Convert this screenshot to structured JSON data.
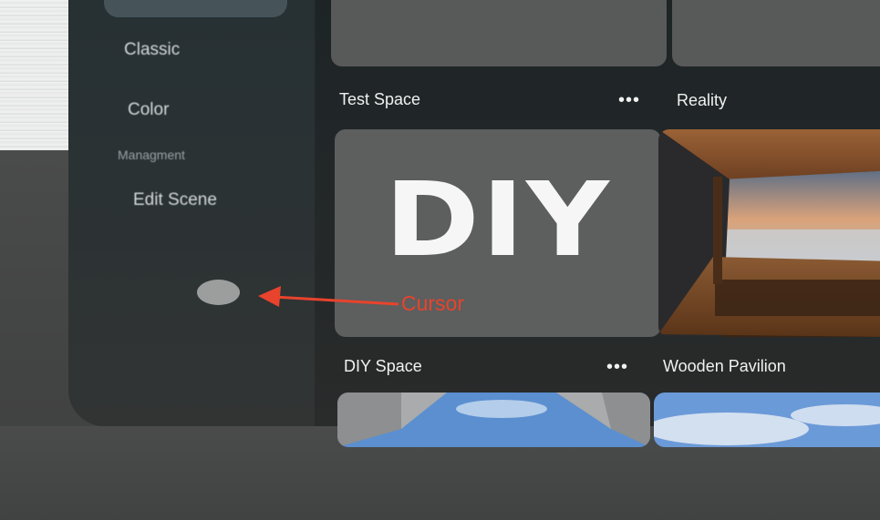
{
  "sidebar": {
    "items": [
      {
        "label": "Classic"
      },
      {
        "label": "Color"
      },
      {
        "label": "Edit Scene"
      }
    ],
    "section_label": "Managment"
  },
  "spaces": [
    {
      "name": "Test Space",
      "more": "•••"
    },
    {
      "name": "Reality"
    },
    {
      "name": "DIY Space",
      "more": "•••"
    },
    {
      "name": "Wooden Pavilion"
    }
  ],
  "diy_tile_text": "DIY",
  "annotation": {
    "label": "Cursor",
    "color": "#e8432c"
  },
  "colors": {
    "sidebar_bg": "#2b3234",
    "content_bg": "#1f2628",
    "tile_gray": "#5d5e5e",
    "text": "#f0f1f1"
  }
}
